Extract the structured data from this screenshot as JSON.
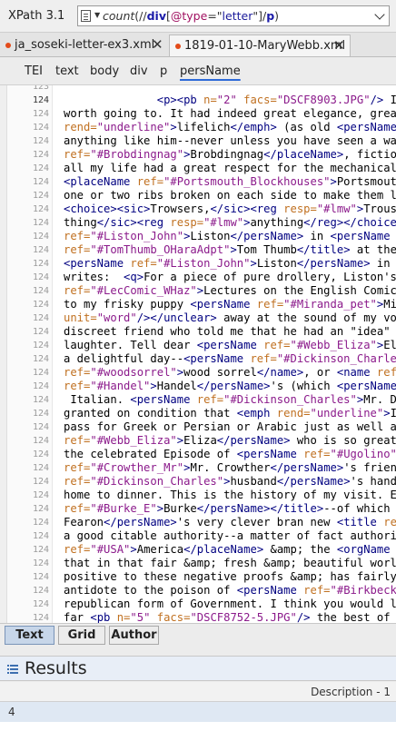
{
  "xpath": {
    "label": "XPath 3.1",
    "expression_parts": [
      {
        "cls": "fn",
        "text": "count"
      },
      {
        "cls": "p",
        "text": "(//"
      },
      {
        "cls": "el",
        "text": "div"
      },
      {
        "cls": "p",
        "text": "["
      },
      {
        "cls": "at",
        "text": "@type"
      },
      {
        "cls": "p",
        "text": "=\""
      },
      {
        "cls": "st",
        "text": "letter"
      },
      {
        "cls": "p",
        "text": "\"]/"
      },
      {
        "cls": "el",
        "text": "p"
      },
      {
        "cls": "p",
        "text": ")"
      }
    ]
  },
  "file_tabs": [
    {
      "name": "ja_soseki-letter-ex3.xml",
      "active": false
    },
    {
      "name": "1819-01-10-MaryWebb.xml",
      "active": true
    }
  ],
  "breadcrumbs": [
    "TEI",
    "text",
    "body",
    "div",
    "p",
    "persName"
  ],
  "line_numbers": [
    "123",
    "124",
    "124",
    "124",
    "124",
    "124",
    "124",
    "124",
    "124",
    "124",
    "124",
    "124",
    "124",
    "124",
    "124",
    "124",
    "124",
    "124",
    "124",
    "124",
    "124",
    "124",
    "124",
    "124",
    "124",
    "124",
    "124",
    "124",
    "124",
    "124",
    "124",
    "124",
    "124",
    "124",
    "124",
    "124",
    "124",
    "124",
    "124",
    "124"
  ],
  "code_lines": [
    [],
    [
      {
        "c": "",
        "t": "              "
      },
      {
        "c": "t",
        "t": "<p><pb"
      },
      {
        "c": "a",
        "t": " n="
      },
      {
        "c": "v",
        "t": "\"2\""
      },
      {
        "c": "a",
        "t": " facs="
      },
      {
        "c": "v",
        "t": "\"DSCF8903.JPG\""
      },
      {
        "c": "t",
        "t": "/>"
      },
      {
        "c": "",
        "t": " I tak"
      }
    ],
    [
      {
        "c": "",
        "t": "worth going to. It had indeed great elegance, great"
      }
    ],
    [
      {
        "c": "a",
        "t": "rend="
      },
      {
        "c": "v",
        "t": "\"underline\""
      },
      {
        "c": "t",
        "t": ">"
      },
      {
        "c": "",
        "t": "lifelich"
      },
      {
        "c": "t",
        "t": "</emph>"
      },
      {
        "c": "",
        "t": " (as old "
      },
      {
        "c": "t",
        "t": "<persName"
      },
      {
        "c": "a",
        "t": " r"
      }
    ],
    [
      {
        "c": "",
        "t": "anything like him--never unless you have seen a wasp"
      }
    ],
    [
      {
        "c": "a",
        "t": "ref="
      },
      {
        "c": "v",
        "t": "\"#Brobdingnag\""
      },
      {
        "c": "t",
        "t": ">"
      },
      {
        "c": "",
        "t": "Brobdingnag"
      },
      {
        "c": "t",
        "t": "</placeName>"
      },
      {
        "c": "",
        "t": ", fictiona"
      }
    ],
    [
      {
        "c": "",
        "t": "all my life had a great respect for the mechanical i"
      }
    ],
    [
      {
        "c": "t",
        "t": "<placeName"
      },
      {
        "c": "a",
        "t": " ref="
      },
      {
        "c": "v",
        "t": "\"#Portsmouth_Blockhouses\""
      },
      {
        "c": "t",
        "t": ">"
      },
      {
        "c": "",
        "t": "Portsmouth "
      }
    ],
    [
      {
        "c": "",
        "t": "one or two ribs broken on each side to make them lie"
      }
    ],
    [
      {
        "c": "t",
        "t": "<choice><sic>"
      },
      {
        "c": "",
        "t": "Trowsers,"
      },
      {
        "c": "t",
        "t": "</sic><reg"
      },
      {
        "c": "a",
        "t": " resp="
      },
      {
        "c": "v",
        "t": "\"#lmw\""
      },
      {
        "c": "t",
        "t": ">"
      },
      {
        "c": "",
        "t": "Trouser"
      }
    ],
    [
      {
        "c": "",
        "t": "thing"
      },
      {
        "c": "t",
        "t": "</sic><reg"
      },
      {
        "c": "a",
        "t": " resp="
      },
      {
        "c": "v",
        "t": "\"#lmw\""
      },
      {
        "c": "t",
        "t": ">"
      },
      {
        "c": "",
        "t": "anything"
      },
      {
        "c": "t",
        "t": "</reg></choice>"
      }
    ],
    [
      {
        "c": "a",
        "t": "ref="
      },
      {
        "c": "v",
        "t": "\"#Liston_John\""
      },
      {
        "c": "t",
        "t": ">"
      },
      {
        "c": "",
        "t": "Liston"
      },
      {
        "c": "t",
        "t": "</persName>"
      },
      {
        "c": "",
        "t": " in "
      },
      {
        "c": "t",
        "t": "<persName"
      },
      {
        "c": "a",
        "t": " re"
      }
    ],
    [
      {
        "c": "a",
        "t": "ref="
      },
      {
        "c": "v",
        "t": "\"#TomThumb_OHaraAdpt\""
      },
      {
        "c": "t",
        "t": ">"
      },
      {
        "c": "",
        "t": "Tom Thumb"
      },
      {
        "c": "t",
        "t": "</title>"
      },
      {
        "c": "",
        "t": " at the "
      },
      {
        "c": "t",
        "t": "<"
      }
    ],
    [
      {
        "c": "t",
        "t": "<persName"
      },
      {
        "c": "a",
        "t": " ref="
      },
      {
        "c": "v",
        "t": "\"#Liston_John\""
      },
      {
        "c": "t",
        "t": ">"
      },
      {
        "c": "",
        "t": "Liston"
      },
      {
        "c": "t",
        "t": "</persName>"
      },
      {
        "c": "",
        "t": " in th"
      }
    ],
    [
      {
        "c": "",
        "t": "writes:  "
      },
      {
        "c": "t",
        "t": "<q>"
      },
      {
        "c": "",
        "t": "For a piece of pure drollery, Liston's "
      },
      {
        "c": "t",
        "t": "<"
      }
    ],
    [
      {
        "c": "a",
        "t": "ref="
      },
      {
        "c": "v",
        "t": "\"#LecComic_WHaz\""
      },
      {
        "c": "t",
        "t": ">"
      },
      {
        "c": "",
        "t": "Lectures on the English Comic W"
      }
    ],
    [
      {
        "c": "",
        "t": "to my frisky puppy "
      },
      {
        "c": "t",
        "t": "<persName"
      },
      {
        "c": "a",
        "t": " ref="
      },
      {
        "c": "v",
        "t": "\"#Miranda_pet\""
      },
      {
        "c": "t",
        "t": ">"
      },
      {
        "c": "",
        "t": "Mira"
      }
    ],
    [
      {
        "c": "a",
        "t": "unit="
      },
      {
        "c": "v",
        "t": "\"word\""
      },
      {
        "c": "t",
        "t": "/></unclear>"
      },
      {
        "c": "",
        "t": " away at the sound of my voic"
      }
    ],
    [
      {
        "c": "",
        "t": "discreet friend who told me that he had an \"idea\" (a"
      }
    ],
    [
      {
        "c": "",
        "t": "laughter. Tell dear "
      },
      {
        "c": "t",
        "t": "<persName"
      },
      {
        "c": "a",
        "t": " ref="
      },
      {
        "c": "v",
        "t": "\"#Webb_Eliza\""
      },
      {
        "c": "t",
        "t": ">"
      },
      {
        "c": "",
        "t": "Eliz"
      }
    ],
    [
      {
        "c": "",
        "t": "a delightful day--"
      },
      {
        "c": "t",
        "t": "<persName"
      },
      {
        "c": "a",
        "t": " ref="
      },
      {
        "c": "v",
        "t": "\"#Dickinson_Charles\""
      }
    ],
    [
      {
        "c": "a",
        "t": "ref="
      },
      {
        "c": "v",
        "t": "\"#woodsorrel\""
      },
      {
        "c": "t",
        "t": ">"
      },
      {
        "c": "",
        "t": "wood sorrel"
      },
      {
        "c": "t",
        "t": "</name>"
      },
      {
        "c": "",
        "t": ", or "
      },
      {
        "c": "t",
        "t": "<name"
      },
      {
        "c": "a",
        "t": " ref="
      },
      {
        "c": "v",
        "t": "\""
      }
    ],
    [
      {
        "c": "a",
        "t": "ref="
      },
      {
        "c": "v",
        "t": "\"#Handel\""
      },
      {
        "c": "t",
        "t": ">"
      },
      {
        "c": "",
        "t": "Handel"
      },
      {
        "c": "t",
        "t": "</persName>"
      },
      {
        "c": "",
        "t": "'s (which "
      },
      {
        "c": "t",
        "t": "<persName"
      },
      {
        "c": "a",
        "t": " re"
      }
    ],
    [
      {
        "c": "",
        "t": " Italian. "
      },
      {
        "c": "t",
        "t": "<persName"
      },
      {
        "c": "a",
        "t": " ref="
      },
      {
        "c": "v",
        "t": "\"#Dickinson_Charles\""
      },
      {
        "c": "t",
        "t": ">"
      },
      {
        "c": "",
        "t": "Mr. Dic"
      }
    ],
    [
      {
        "c": "",
        "t": "granted on condition that "
      },
      {
        "c": "t",
        "t": "<emph"
      },
      {
        "c": "a",
        "t": " rend="
      },
      {
        "c": "v",
        "t": "\"underline\""
      },
      {
        "c": "t",
        "t": ">"
      },
      {
        "c": "",
        "t": "I"
      },
      {
        "c": "t",
        "t": "</"
      }
    ],
    [
      {
        "c": "",
        "t": "pass for Greek or Persian or Arabic just as well as "
      }
    ],
    [
      {
        "c": "a",
        "t": "ref="
      },
      {
        "c": "v",
        "t": "\"#Webb_Eliza\""
      },
      {
        "c": "t",
        "t": ">"
      },
      {
        "c": "",
        "t": "Eliza"
      },
      {
        "c": "t",
        "t": "</persName>"
      },
      {
        "c": "",
        "t": " who is so great a"
      }
    ],
    [
      {
        "c": "",
        "t": "the celebrated Episode of "
      },
      {
        "c": "t",
        "t": "<persName"
      },
      {
        "c": "a",
        "t": " ref="
      },
      {
        "c": "v",
        "t": "\"#Ugolino\""
      },
      {
        "c": "t",
        "t": ">"
      },
      {
        "c": "",
        "t": "C"
      }
    ],
    [
      {
        "c": "a",
        "t": "ref="
      },
      {
        "c": "v",
        "t": "\"#Crowther_Mr\""
      },
      {
        "c": "t",
        "t": ">"
      },
      {
        "c": "",
        "t": "Mr. Crowther"
      },
      {
        "c": "t",
        "t": "</persName>"
      },
      {
        "c": "",
        "t": "'s friend "
      }
    ],
    [
      {
        "c": "a",
        "t": "ref="
      },
      {
        "c": "v",
        "t": "\"#Dickinson_Charles\""
      },
      {
        "c": "t",
        "t": ">"
      },
      {
        "c": "",
        "t": "husband"
      },
      {
        "c": "t",
        "t": "</persName>"
      },
      {
        "c": "",
        "t": "'s hand,"
      }
    ],
    [
      {
        "c": "",
        "t": "home to dinner. This is the history of my visit. Eve"
      }
    ],
    [
      {
        "c": "a",
        "t": "ref="
      },
      {
        "c": "v",
        "t": "\"#Burke_E\""
      },
      {
        "c": "t",
        "t": ">"
      },
      {
        "c": "",
        "t": "Burke"
      },
      {
        "c": "t",
        "t": "</persName></title>"
      },
      {
        "c": "",
        "t": "--of which I "
      }
    ],
    [
      {
        "c": "",
        "t": "Fearon"
      },
      {
        "c": "t",
        "t": "</persName>"
      },
      {
        "c": "",
        "t": "'s very clever bran new "
      },
      {
        "c": "t",
        "t": "<title"
      },
      {
        "c": "a",
        "t": " ref"
      }
    ],
    [
      {
        "c": "",
        "t": "a good citable authority--a matter of fact authority"
      }
    ],
    [
      {
        "c": "a",
        "t": "ref="
      },
      {
        "c": "v",
        "t": "\"#USA\""
      },
      {
        "c": "t",
        "t": ">"
      },
      {
        "c": "",
        "t": "America"
      },
      {
        "c": "t",
        "t": "</placeName>"
      },
      {
        "c": "",
        "t": " &amp; the "
      },
      {
        "c": "t",
        "t": "<orgName"
      },
      {
        "c": "a",
        "t": " re"
      }
    ],
    [
      {
        "c": "",
        "t": "that in that fair &amp; fresh &amp; beautiful world "
      }
    ],
    [
      {
        "c": "",
        "t": "positive to these negative proofs &amp; has fairly s"
      }
    ],
    [
      {
        "c": "",
        "t": "antidote to the poison of "
      },
      {
        "c": "t",
        "t": "<persName"
      },
      {
        "c": "a",
        "t": " ref="
      },
      {
        "c": "v",
        "t": "\"#Birkbeck_M"
      }
    ],
    [
      {
        "c": "",
        "t": "republican form of Government. I think you would lik"
      }
    ],
    [
      {
        "c": "",
        "t": "far "
      },
      {
        "c": "t",
        "t": "<pb"
      },
      {
        "c": "a",
        "t": " n="
      },
      {
        "c": "v",
        "t": "\"5\""
      },
      {
        "c": "a",
        "t": " facs="
      },
      {
        "c": "v",
        "t": "\"DSCF8752-5.JPG\""
      },
      {
        "c": "t",
        "t": "/>"
      },
      {
        "c": "",
        "t": " the best of "
      },
      {
        "c": "t",
        "t": "<p"
      }
    ]
  ],
  "mode_tabs": [
    {
      "label": "Text",
      "active": true
    },
    {
      "label": "Grid",
      "active": false
    },
    {
      "label": "Author",
      "active": false
    }
  ],
  "results": {
    "title": "Results",
    "column_description": "Description - 1",
    "row_value": "4"
  },
  "colors": {
    "tag": "#000080",
    "attribute": "#c07020",
    "value": "#8b1a8b",
    "tab_dot": "#e34b1a",
    "active_mode_tab": "#c7d6e9"
  }
}
